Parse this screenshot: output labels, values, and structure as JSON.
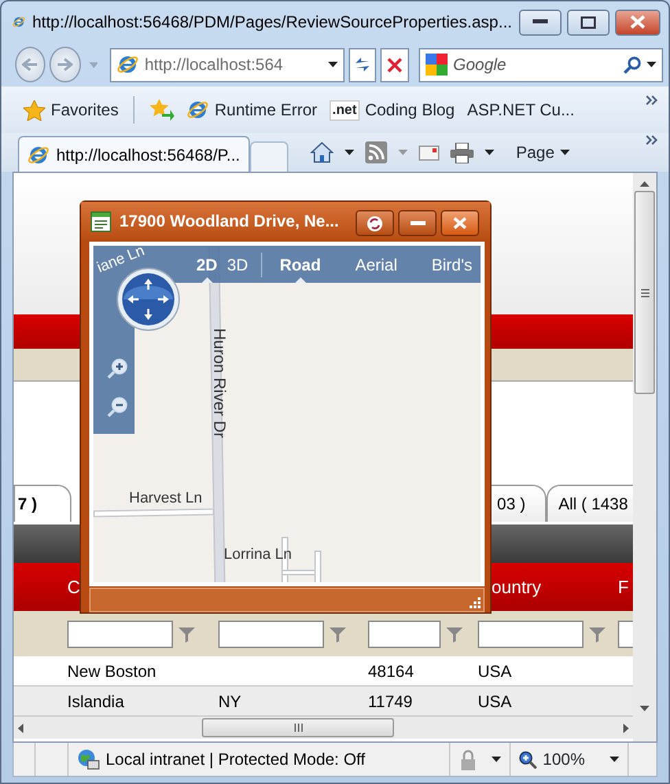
{
  "window": {
    "title": "http://localhost:56468/PDM/Pages/ReviewSourceProperties.asp..."
  },
  "address_bar": {
    "value": "http://localhost:564"
  },
  "search": {
    "placeholder": "Google"
  },
  "favorites_bar": {
    "label": "Favorites",
    "links": [
      {
        "label": "Runtime Error",
        "kind": "page"
      },
      {
        "label": "Coding Blog",
        "kind": "net",
        "icon_text": ".net"
      },
      {
        "label": "ASP.NET Cu...",
        "kind": "plain"
      }
    ]
  },
  "tabs": [
    {
      "label": "http://localhost:56468/P...",
      "selected": true
    }
  ],
  "command_bar": {
    "page_menu": "Page"
  },
  "page": {
    "tabs": [
      {
        "label": "7 )",
        "selected": true
      },
      {
        "label": "03 )",
        "selected": false
      },
      {
        "label": "All ( 1438",
        "selected": false
      }
    ],
    "table": {
      "header": {
        "column_1": "C",
        "column_4": "ountry",
        "column_5": "F"
      },
      "rows": [
        {
          "column_1": "New Boston",
          "column_3": "48164",
          "column_4": "USA"
        },
        {
          "column_1": "Islandia",
          "column_2": "NY",
          "column_3": "11749",
          "column_4": "USA"
        }
      ]
    }
  },
  "dialog": {
    "title": "17900 Woodland Drive, Ne...",
    "map": {
      "view_modes": [
        {
          "label": "2D",
          "selected": true
        },
        {
          "label": "3D",
          "selected": false
        }
      ],
      "map_styles": [
        {
          "label": "Road",
          "selected": true
        },
        {
          "label": "Aerial",
          "selected": false
        },
        {
          "label": "Bird's",
          "selected": false
        }
      ],
      "streets": [
        {
          "name": "iane Ln",
          "kind": "slanted"
        },
        {
          "name": "Huron River Dr",
          "kind": "vertical"
        },
        {
          "name": "Harvest Ln",
          "kind": "horizontal"
        },
        {
          "name": "Lorrina Ln",
          "kind": "horizontal"
        }
      ]
    }
  },
  "status_bar": {
    "zone": "Local intranet | Protected Mode: Off",
    "zoom": "100%"
  }
}
